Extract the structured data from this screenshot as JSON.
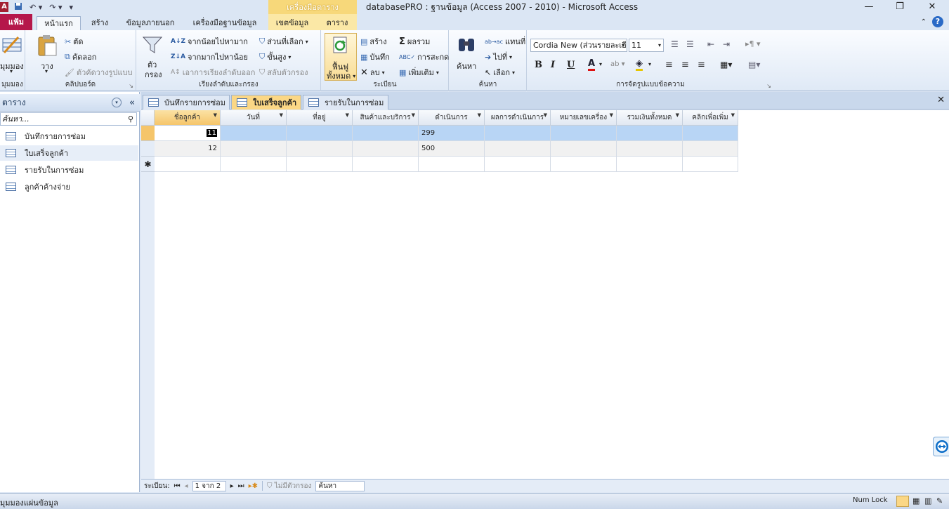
{
  "titlebar": {
    "app_letter": "A",
    "window_title": "databasePRO : ฐานข้อมูล (Access 2007 - 2010) - Microsoft Access",
    "contextual_header": "เครื่องมือตาราง",
    "minimize": "—",
    "maximize": "❐",
    "close": "✕"
  },
  "ribbon_tabs": {
    "file": "แฟ้ม",
    "home": "หน้าแรก",
    "create": "สร้าง",
    "external": "ข้อมูลภายนอก",
    "dbtools": "เครื่องมือฐานข้อมูล",
    "fields": "เขตข้อมูล",
    "table": "ตาราง"
  },
  "ribbon": {
    "views": {
      "label": "มุมมอง",
      "group": "มุมมอง"
    },
    "clipboard": {
      "paste": "วาง",
      "cut": "ตัด",
      "copy": "คัดลอก",
      "format_painter": "ตัวคัดวางรูปแบบ",
      "group": "คลิปบอร์ด"
    },
    "sort_filter": {
      "filter": "ตัว\nกรอง",
      "filter_l1": "ตัว",
      "filter_l2": "กรอง",
      "ascending": "จากน้อยไปหามาก",
      "descending": "จากมากไปหาน้อย",
      "remove_sort": "เอาการเรียงลำดับออก",
      "selection": "ส่วนที่เลือก",
      "advanced": "ขั้นสูง",
      "toggle_filter": "สลับตัวกรอง",
      "group": "เรียงลำดับและกรอง"
    },
    "records": {
      "refresh_l1": "ฟื้นฟู",
      "refresh_l2": "ทั้งหมด",
      "new": "สร้าง",
      "save": "บันทึก",
      "delete": "ลบ",
      "totals": "ผลรวม",
      "spelling": "การสะกด",
      "more": "เพิ่มเติม",
      "group": "ระเบียน"
    },
    "find": {
      "find": "ค้นหา",
      "replace": "แทนที่",
      "goto": "ไปที่",
      "select": "เลือก",
      "group": "ค้นหา"
    },
    "text_format": {
      "font": "Cordia New (ส่วนรายละเอี",
      "size": "11",
      "group": "การจัดรูปแบบข้อความ"
    }
  },
  "navpane": {
    "title": "ตาราง",
    "search_placeholder": "ค้นหา...",
    "items": [
      {
        "label": "บันทึกรายการซ่อม"
      },
      {
        "label": "ใบเสร็จลูกค้า"
      },
      {
        "label": "รายรับในการซ่อม"
      },
      {
        "label": "ลูกค้าค้างจ่าย"
      }
    ]
  },
  "doc_tabs": [
    {
      "label": "บันทึกรายการซ่อม"
    },
    {
      "label": "ใบเสร็จลูกค้า"
    },
    {
      "label": "รายรับในการซ่อม"
    }
  ],
  "datasheet": {
    "columns": [
      "ชื่อลูกค้า",
      "วันที่",
      "ที่อยู่",
      "สินค้าและบริการ",
      "ดำเนินการ",
      "ผลการดำเนินการ",
      "หมายเลขเครื่อง",
      "รวมเงินทั้งหมด",
      "คลิกเพื่อเพิ่ม"
    ],
    "rows": [
      [
        "11",
        "",
        "",
        "",
        "299",
        "",
        "",
        "",
        ""
      ],
      [
        "12",
        "",
        "",
        "",
        "500",
        "",
        "",
        "",
        ""
      ]
    ],
    "new_row_marker": "✱"
  },
  "recnav": {
    "label": "ระเบียน:",
    "position": "1 จาก 2",
    "no_filter": "ไม่มีตัวกรอง",
    "search": "ค้นหา"
  },
  "statusbar": {
    "left": "มุมมองแผ่นข้อมูล",
    "numlock": "Num Lock"
  },
  "colors": {
    "file_tab": "#b5174a",
    "active_tab": "#fbd785",
    "selected_row": "#b8d5f5"
  }
}
